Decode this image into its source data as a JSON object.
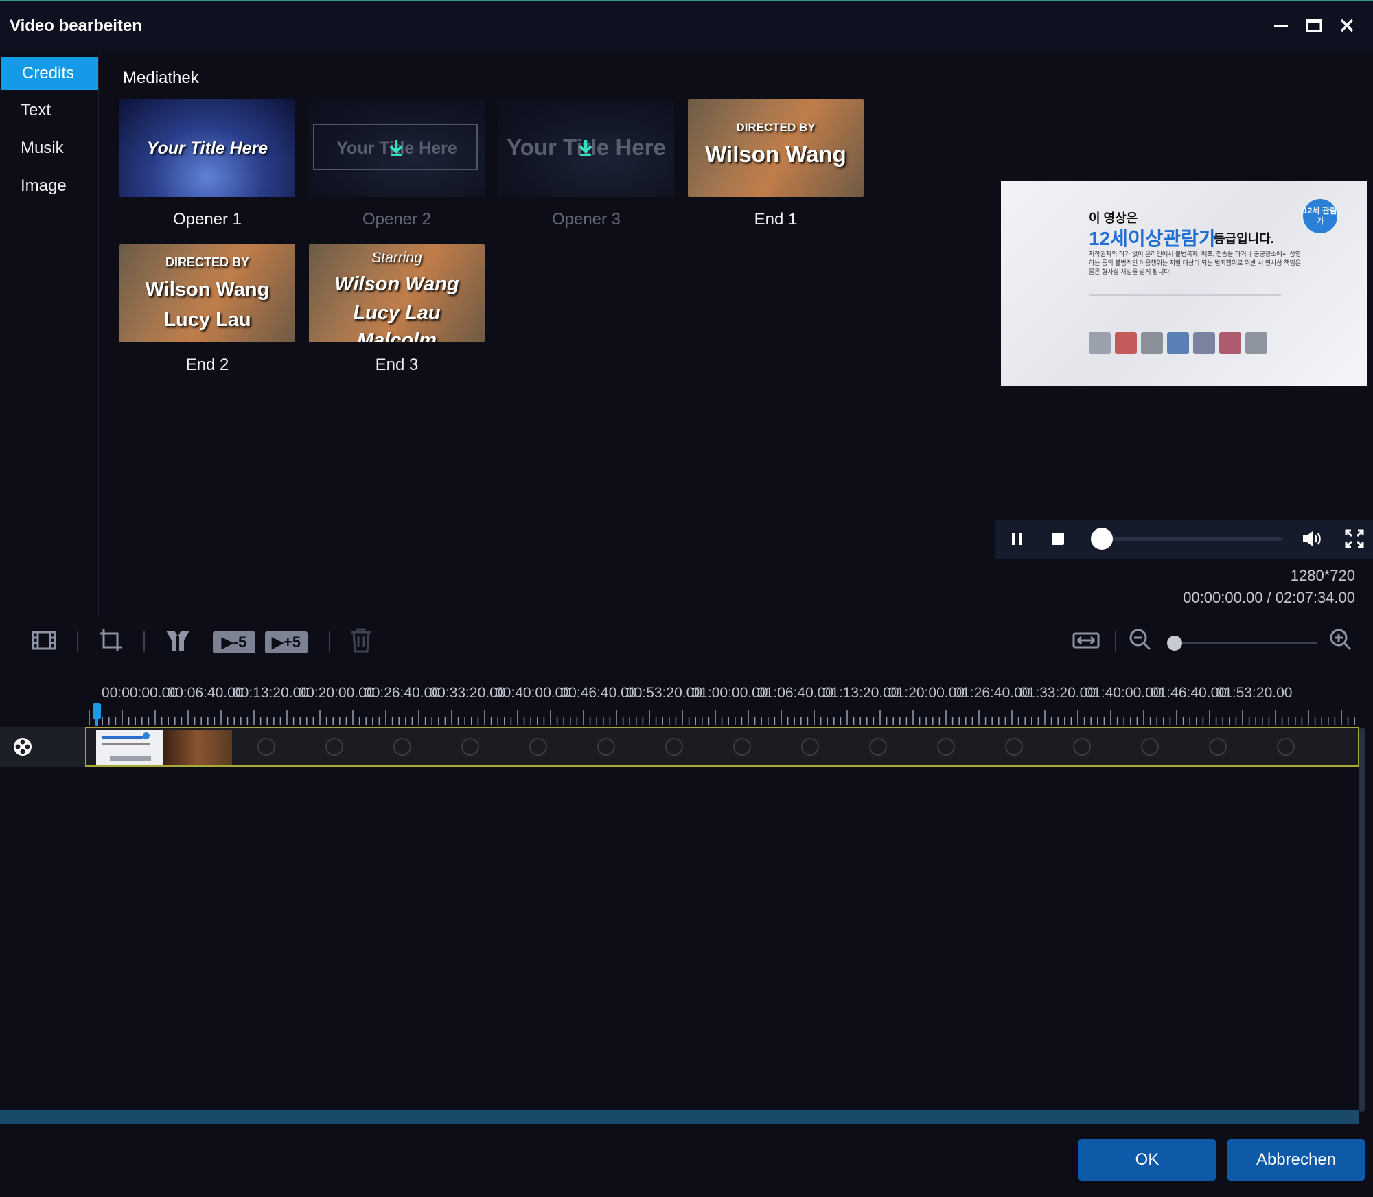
{
  "window": {
    "title": "Video bearbeiten",
    "minimize_icon": "minimize-icon",
    "maximize_icon": "maximize-icon",
    "close_icon": "close-icon"
  },
  "sidebar": {
    "items": [
      {
        "label": "Credits",
        "active": true
      },
      {
        "label": "Text",
        "active": false
      },
      {
        "label": "Musik",
        "active": false
      },
      {
        "label": "Image",
        "active": false
      }
    ]
  },
  "library": {
    "heading": "Mediathek",
    "items": [
      {
        "caption": "Opener 1",
        "thumb_text": "Your Title Here",
        "available": true
      },
      {
        "caption": "Opener 2",
        "thumb_text": "Your Title Here",
        "available": false
      },
      {
        "caption": "Opener 3",
        "thumb_text": "Your Title Here",
        "available": false
      },
      {
        "caption": "End 1",
        "thumb_small": "DIRECTED BY",
        "thumb_text": "Wilson Wang",
        "available": true
      },
      {
        "caption": "End 2",
        "thumb_small": "DIRECTED BY",
        "thumb_line1": "Wilson Wang",
        "thumb_line2": "Lucy Lau",
        "available": true
      },
      {
        "caption": "End 3",
        "thumb_small": "Starring",
        "thumb_line1": "Wilson Wang",
        "thumb_line2": "Lucy Lau",
        "thumb_line3": "Malcolm",
        "available": true
      }
    ]
  },
  "preview": {
    "rating_line1": "이 영상은",
    "rating_line2a": "12세이상관람가",
    "rating_line2b": "등급입니다.",
    "rating_badge": "12세 관람가",
    "rating_body": "저작권자의 허가 없이 온라인에서 불법복제, 배포, 전송을 하거나 공공장소에서 상영하는 등의 불법적인 이용행위는 저벌 대상이 되는 범죄행위로 위반 시 민사상 책임은 물론 형사상 처벌을 받게 됩니다.",
    "resolution": "1280*720",
    "time": "00:00:00.00 / 02:07:34.00",
    "playback_progress": 0.0
  },
  "controls": {
    "pause_icon": "pause-icon",
    "stop_icon": "stop-icon",
    "volume_icon": "volume-icon",
    "fullscreen_icon": "fullscreen-icon"
  },
  "toolbar": {
    "minus5": "-5",
    "plus5": "+5",
    "zoom_level": 0.0
  },
  "timeline": {
    "ruler_labels": [
      "00:00:00.00",
      "00:06:40.00",
      "00:13:20.00",
      "00:20:00.00",
      "00:26:40.00",
      "00:33:20.00",
      "00:40:00.00",
      "00:46:40.00",
      "00:53:20.00",
      "01:00:00.00",
      "01:06:40.00",
      "01:13:20.00",
      "01:20:00.00",
      "01:26:40.00",
      "01:33:20.00",
      "01:40:00.00",
      "01:46:40.00",
      "01:53:20.00"
    ]
  },
  "footer": {
    "ok_label": "OK",
    "cancel_label": "Abbrechen"
  }
}
